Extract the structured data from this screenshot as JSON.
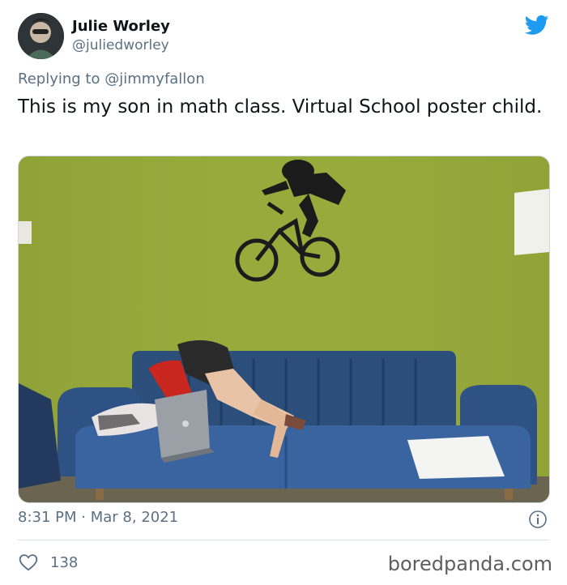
{
  "tweet": {
    "author_name": "Julie Worley",
    "author_handle": "@juliedworley",
    "replying_prefix": "Replying to",
    "replying_mention": "@jimmyfallon",
    "text": "This is my son in math class. Virtual School poster child.",
    "time": "8:31 PM",
    "separator": "·",
    "date": "Mar 8, 2021",
    "like_count": "138"
  },
  "icons": {
    "brand": "twitter-bird-icon",
    "info": "info-icon",
    "like": "heart-icon"
  },
  "watermark": "boredpanda.com",
  "colors": {
    "twitter_blue": "#1d9bf0",
    "secondary_text": "#5b7083",
    "wall_green": "#96a83a",
    "sofa_blue": "#2c4e7a"
  }
}
